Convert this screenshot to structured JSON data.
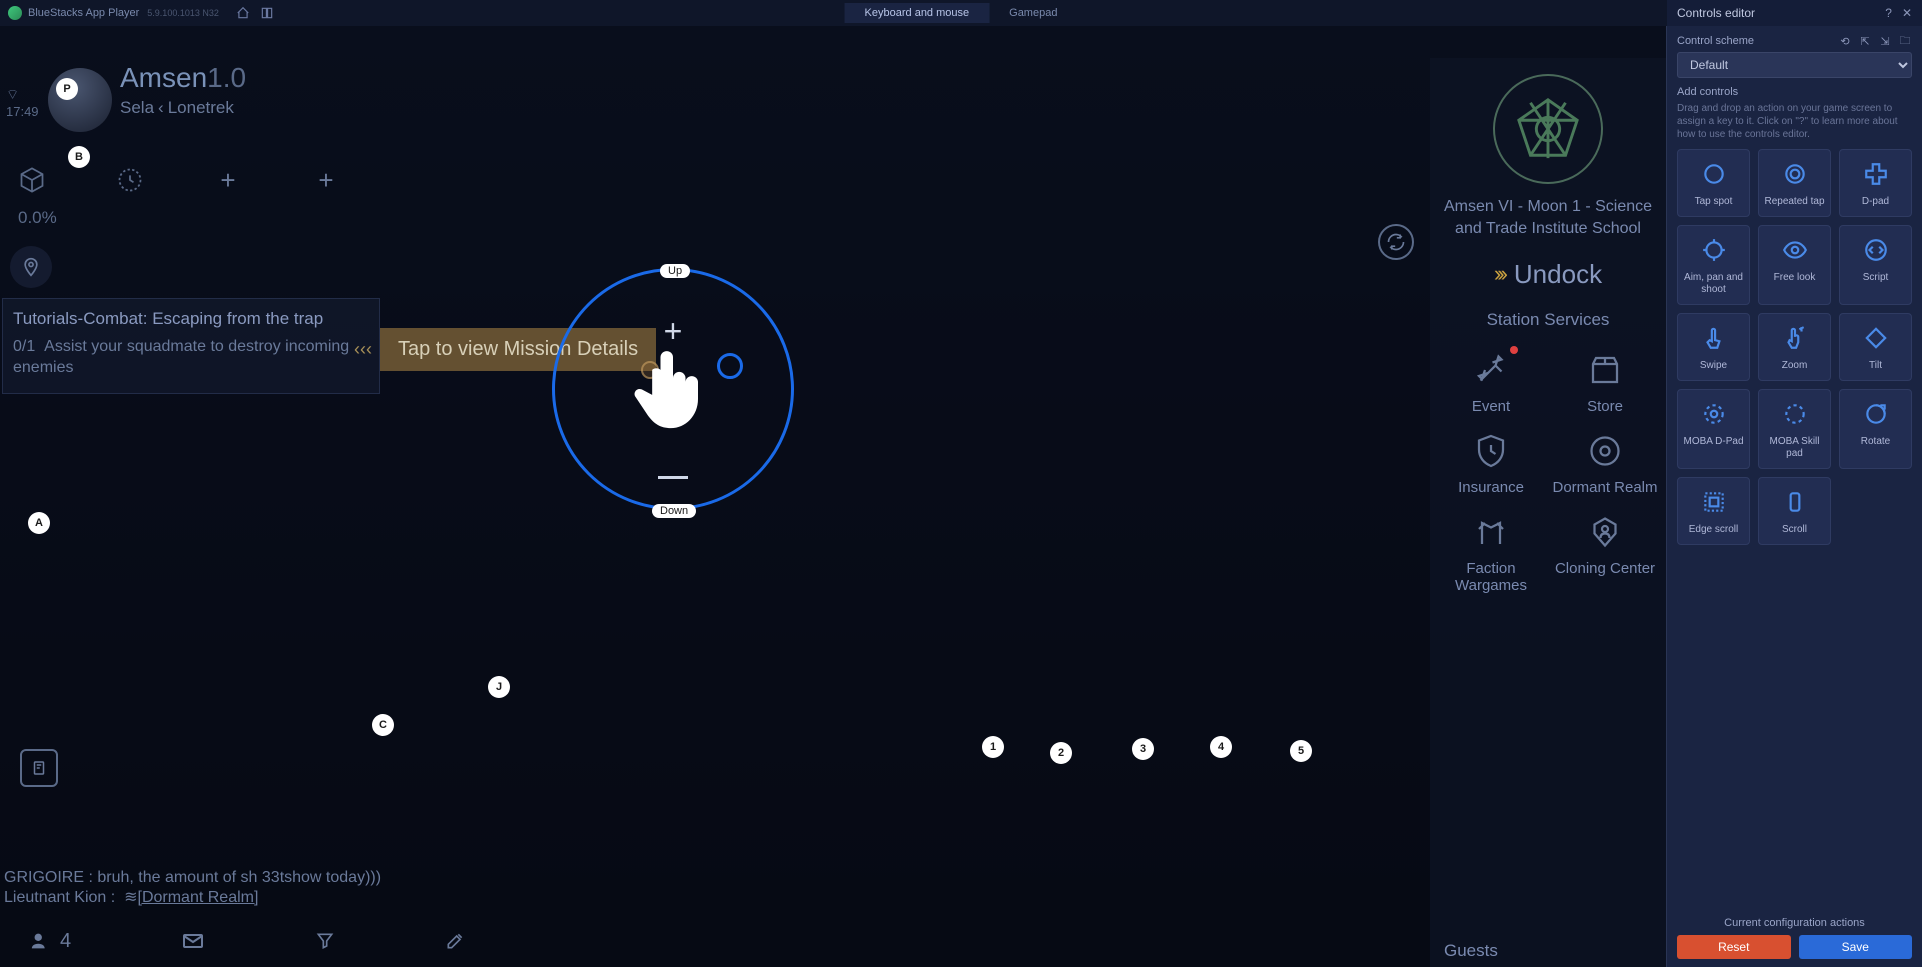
{
  "titlebar": {
    "app": "BlueStacks App Player",
    "version": "5.9.100.1013 N32",
    "tabs": {
      "kbm": "Keyboard and mouse",
      "gamepad": "Gamepad"
    }
  },
  "game": {
    "player_name": "Amsen",
    "player_ver": "1.0",
    "location": "Sela",
    "location2": "Lonetrek",
    "time": "17:49",
    "percent": "0.0%",
    "mission_title": "Tutorials-Combat: Escaping from the trap",
    "mission_progress": "0/1",
    "mission_desc": "Assist your squadmate to destroy incoming enemies",
    "mission_tap": "Tap to view Mission Details",
    "ring_up": "Up",
    "ring_down": "Down",
    "chat1": "GRIGOIRE : bruh, the amount of sh 33tshow today)))",
    "chat2_name": "Lieutnant Kion :",
    "chat2_link": "[Dormant Realm]",
    "station_name": "Amsen VI - Moon 1 - Science and Trade Institute School",
    "undock": "Undock",
    "station_services": "Station Services",
    "services": {
      "event": "Event",
      "store": "Store",
      "insurance": "Insurance",
      "dormant": "Dormant Realm",
      "faction": "Faction Wargames",
      "cloning": "Cloning Center"
    },
    "guests": "Guests",
    "bottom_count": "4"
  },
  "keys": {
    "p": "P",
    "b": "B",
    "a": "A",
    "j": "J",
    "c": "C",
    "n1": "1",
    "n2": "2",
    "n3": "3",
    "n4": "4",
    "n5": "5"
  },
  "editor": {
    "title": "Controls editor",
    "scheme_label": "Control scheme",
    "scheme_value": "Default",
    "add_label": "Add controls",
    "add_desc": "Drag and drop an action on your game screen to assign a key to it. Click on \"?\" to learn more about how to use the controls editor.",
    "controls": {
      "tap": "Tap spot",
      "repeat": "Repeated tap",
      "dpad": "D-pad",
      "aim": "Aim, pan and shoot",
      "freelook": "Free look",
      "script": "Script",
      "swipe": "Swipe",
      "zoom": "Zoom",
      "tilt": "Tilt",
      "mobad": "MOBA D-Pad",
      "mobaskill": "MOBA Skill pad",
      "rotate": "Rotate",
      "edge": "Edge scroll",
      "scroll": "Scroll"
    },
    "footer_status": "Current configuration actions",
    "reset": "Reset",
    "save": "Save"
  }
}
